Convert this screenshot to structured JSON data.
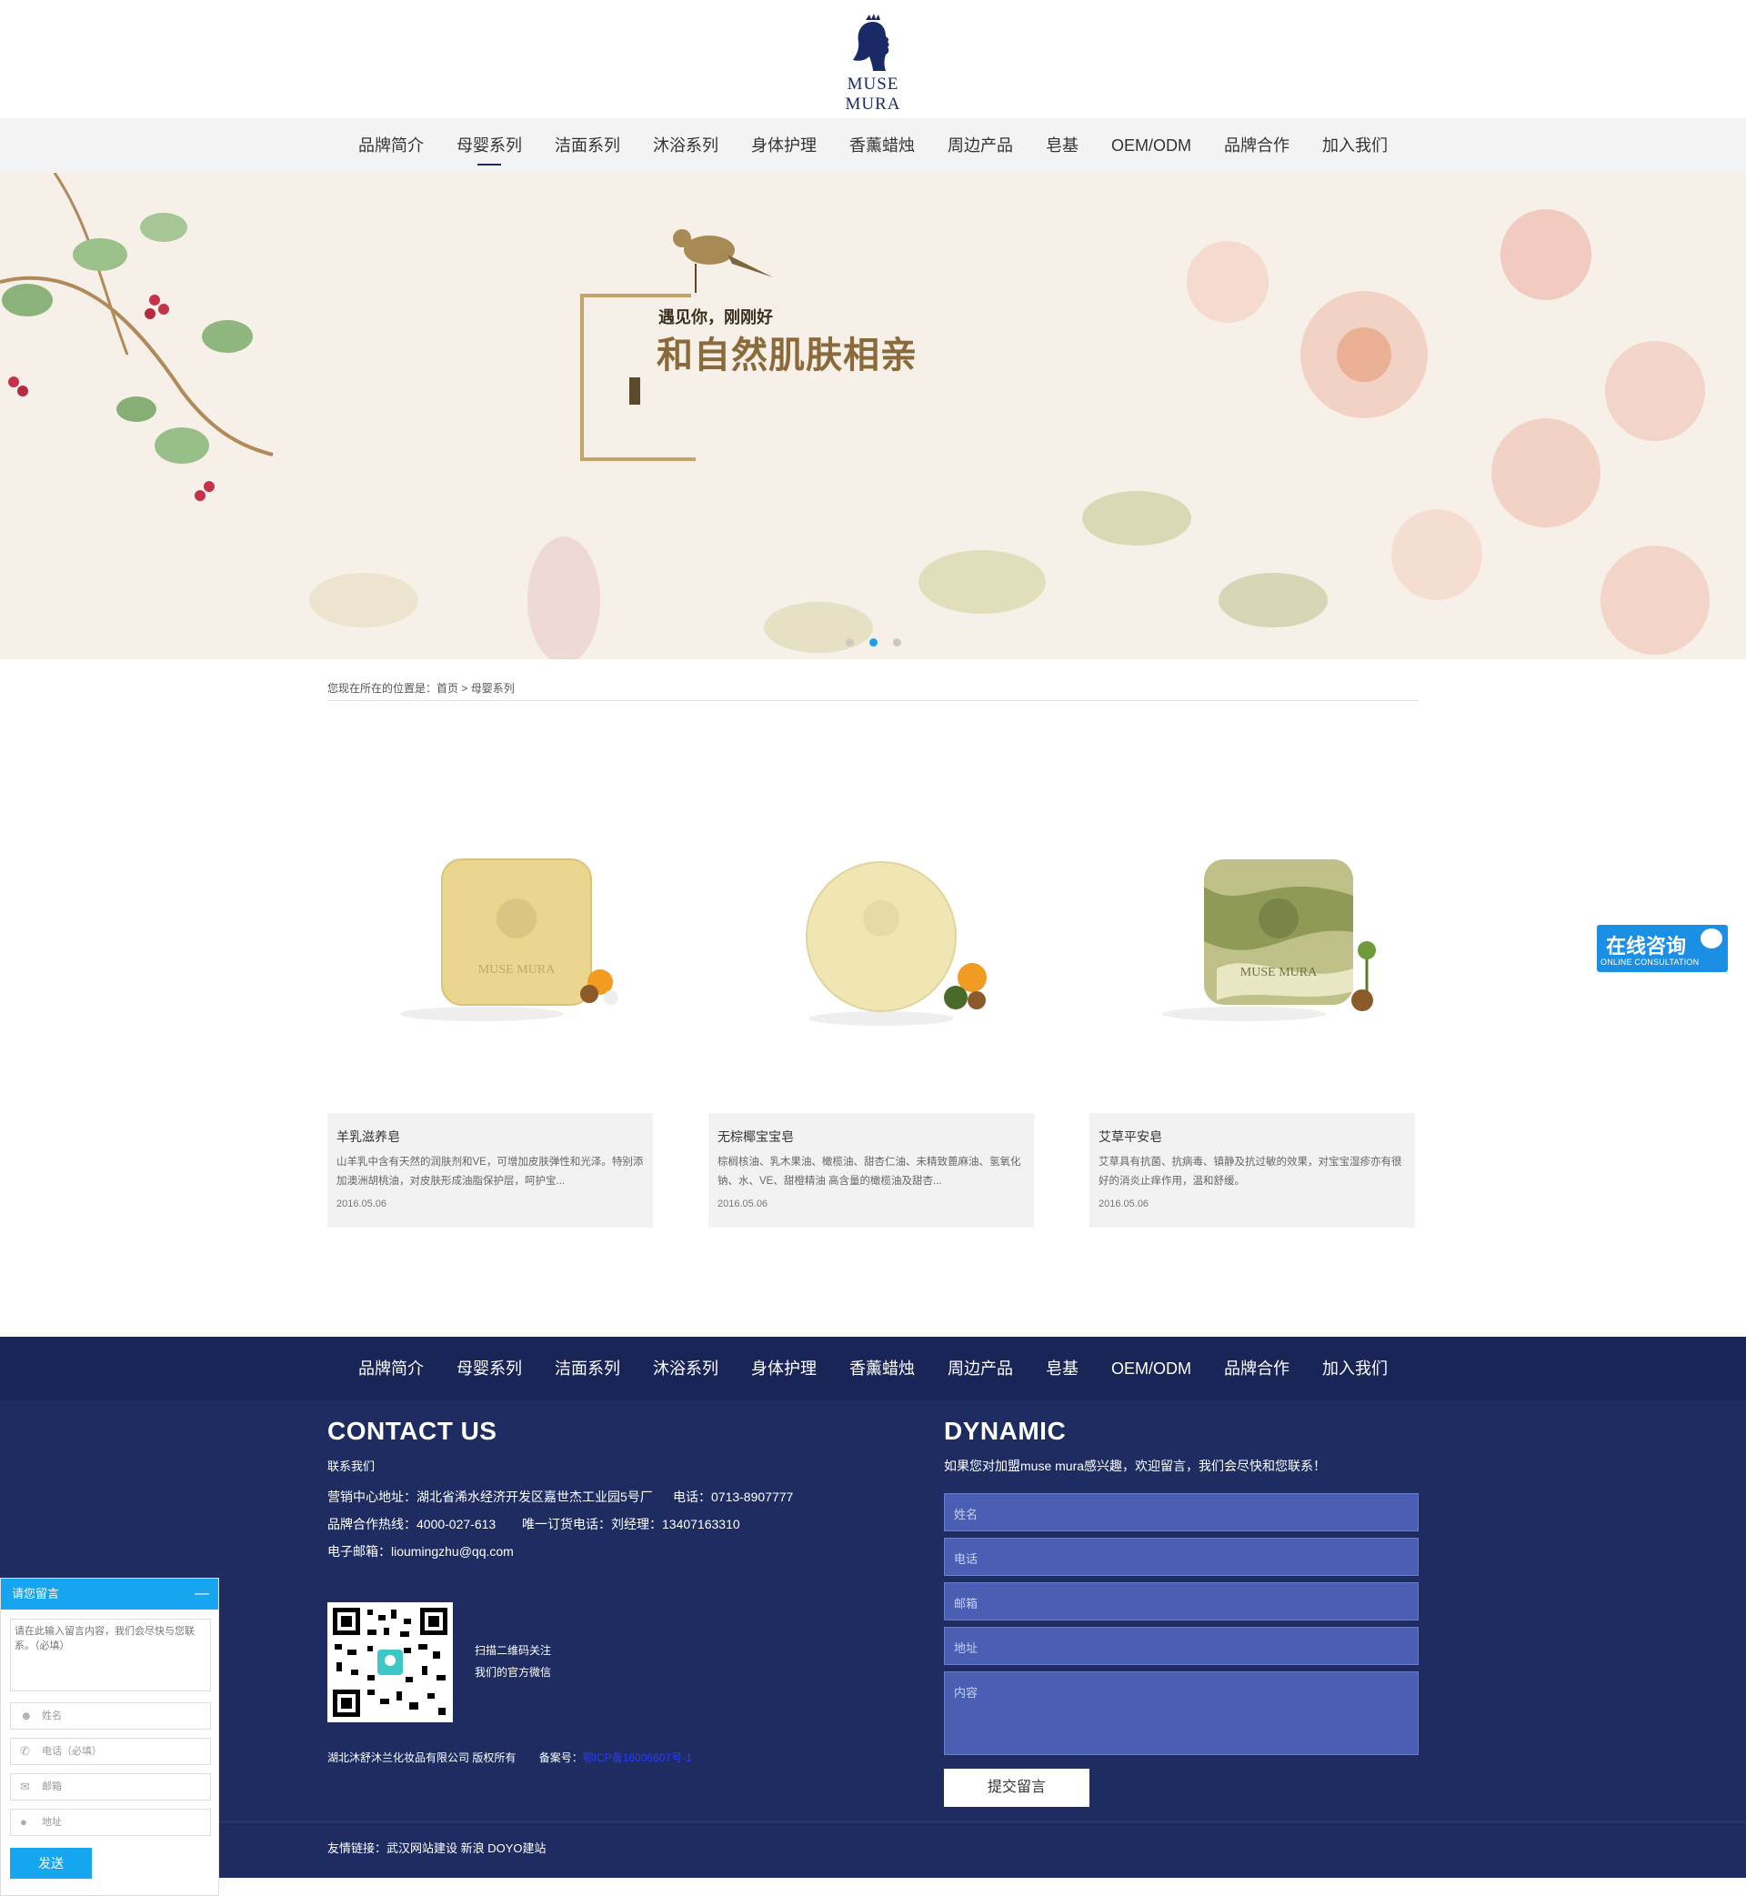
{
  "header": {
    "logo_text": "MUSE MURA"
  },
  "nav": [
    {
      "label": "品牌简介"
    },
    {
      "label": "母婴系列",
      "active": true
    },
    {
      "label": "洁面系列"
    },
    {
      "label": "沐浴系列"
    },
    {
      "label": "身体护理"
    },
    {
      "label": "香薰蜡烛"
    },
    {
      "label": "周边产品"
    },
    {
      "label": "皂基"
    },
    {
      "label": "OEM/ODM"
    },
    {
      "label": "品牌合作"
    },
    {
      "label": "加入我们"
    }
  ],
  "banner": {
    "small_text": "遇见你，刚刚好",
    "big_text": "和自然肌肤相亲",
    "active_dot": 2,
    "dot_count": 3
  },
  "breadcrumb": {
    "prefix": "您现在所在的位置是：",
    "home": "首页",
    "sep": " > ",
    "current": "母婴系列"
  },
  "products": [
    {
      "name": "羊乳滋养皂",
      "desc": "山羊乳中含有天然的润肤剂和VE，可增加皮肤弹性和光泽。特别添加澳洲胡桃油，对皮肤形成油脂保护层，呵护宝...",
      "date": "2016.05.06"
    },
    {
      "name": "无棕椰宝宝皂",
      "desc": "棕榈核油、乳木果油、橄榄油、甜杏仁油、未精致蓖麻油、氢氧化钠、水、VE、甜橙精油 高含量的橄榄油及甜杏...",
      "date": "2016.05.06"
    },
    {
      "name": "艾草平安皂",
      "desc": "艾草具有抗菌、抗病毒、镇静及抗过敏的效果，对宝宝湿疹亦有很好的消炎止痒作用，温和舒缓。",
      "date": "2016.05.06"
    }
  ],
  "footer": {
    "contact_title": "CONTACT US",
    "contact_sub": "联系我们",
    "address": "营销中心地址：湖北省浠水经济开发区嘉世杰工业园5号厂",
    "phone": "电话：0713-8907777",
    "hotline": "品牌合作热线：4000-027-613",
    "order_line": "唯一订货电话：刘经理：13407163310",
    "email": "电子邮箱：lioumingzhu@qq.com",
    "qr_line1": "扫描二维码关注",
    "qr_line2": "我们的官方微信",
    "copyright": "湖北沐舒沐兰化妆品有限公司 版权所有",
    "icp_label": "备案号：",
    "icp": "鄂ICP备16006607号-1",
    "dynamic_title": "DYNAMIC",
    "dynamic_sub": "如果您对加盟muse mura感兴趣，欢迎留言，我们会尽快和您联系！",
    "form": {
      "name": "姓名",
      "phone": "电话",
      "email": "邮箱",
      "address": "地址",
      "content": "内容",
      "submit": "提交留言"
    },
    "links": "友情链接：武汉网站建设 新浪 DOYO建站"
  },
  "consult": {
    "big": "在线咨询",
    "small": "ONLINE CONSULTATION"
  },
  "message_box": {
    "title": "请您留言",
    "minimize": "—",
    "textarea_placeholder": "请在此输入留言内容，我们会尽快与您联系。（必填）",
    "name": "姓名",
    "phone": "电话（必填）",
    "email": "邮箱",
    "address": "地址",
    "send": "发送"
  },
  "colors": {
    "nav_bg": "#f3f3f3",
    "footer_bg": "#1e2c62",
    "footer_nav_bg": "#182556",
    "field_bg": "#4a5fb3",
    "accent_blue": "#16a6ef"
  }
}
